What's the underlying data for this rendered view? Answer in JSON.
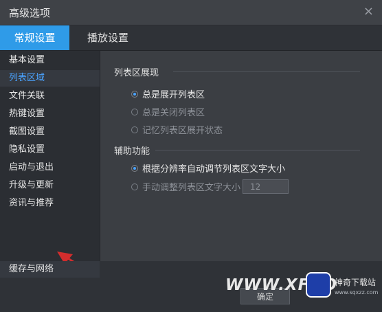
{
  "window": {
    "title": "高级选项",
    "close": "×"
  },
  "tabs": [
    {
      "label": "常规设置"
    },
    {
      "label": "播放设置"
    }
  ],
  "sidebar": {
    "items": [
      {
        "label": "基本设置"
      },
      {
        "label": "列表区域"
      },
      {
        "label": "文件关联"
      },
      {
        "label": "热键设置"
      },
      {
        "label": "截图设置"
      },
      {
        "label": "隐私设置"
      },
      {
        "label": "启动与退出"
      },
      {
        "label": "升级与更新"
      },
      {
        "label": "资讯与推荐"
      }
    ],
    "bottom_item": {
      "label": "缓存与网络"
    }
  },
  "main": {
    "list_display": {
      "title": "列表区展现",
      "options": [
        {
          "label": "总是展开列表区",
          "selected": true
        },
        {
          "label": "总是关闭列表区",
          "selected": false
        },
        {
          "label": "记忆列表区展开状态",
          "selected": false
        }
      ]
    },
    "aux": {
      "title": "辅助功能",
      "options": [
        {
          "label": "根据分辨率自动调节列表区文字大小",
          "selected": true
        },
        {
          "label": "手动调整列表区文字大小",
          "selected": false
        }
      ],
      "font_size_value": "12"
    }
  },
  "footer": {
    "ok_label": "确定"
  },
  "watermark": {
    "left_text": "WWW.XFDO",
    "brand": "神奇下载站",
    "sub": "www.sqxzz.com"
  },
  "colors": {
    "accent": "#2f9be8",
    "selected_text": "#4aa3ff",
    "arrow": "#d22d2d"
  }
}
